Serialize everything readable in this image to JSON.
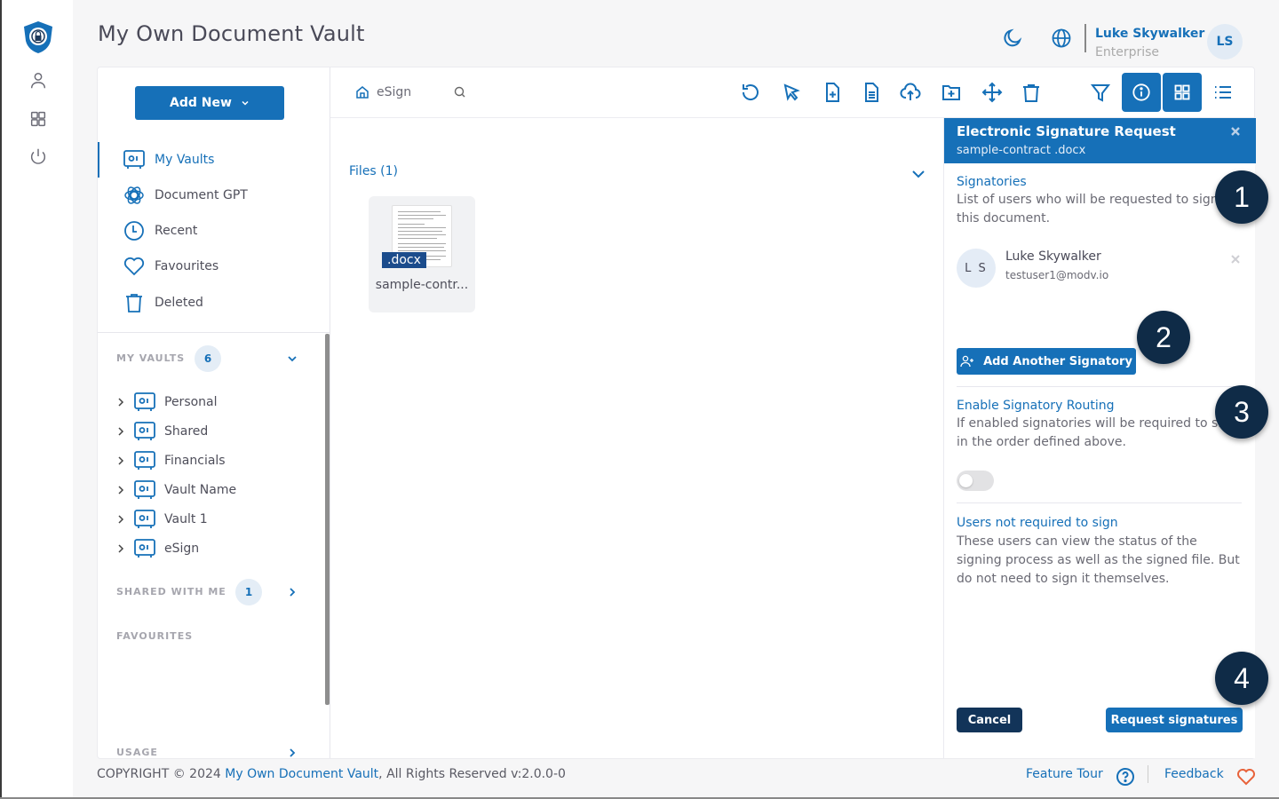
{
  "app": {
    "title": "My Own Document Vault"
  },
  "rail": {
    "icons": [
      "shield-logo",
      "user-icon",
      "grid-icon",
      "power-icon"
    ]
  },
  "header": {
    "icons": [
      "moon-icon",
      "globe-icon"
    ],
    "user": {
      "name": "Luke Skywalker",
      "plan": "Enterprise",
      "initials": "LS"
    }
  },
  "sidebar": {
    "add_new_label": "Add New",
    "nav": [
      {
        "label": "My Vaults",
        "icon": "vault-icon",
        "active": true
      },
      {
        "label": "Document GPT",
        "icon": "gpt-icon",
        "active": false
      },
      {
        "label": "Recent",
        "icon": "clock-icon",
        "active": false
      },
      {
        "label": "Favourites",
        "icon": "heart-icon",
        "active": false
      },
      {
        "label": "Deleted",
        "icon": "trash-icon",
        "active": false
      }
    ],
    "my_vaults": {
      "label": "MY VAULTS",
      "count": "6"
    },
    "vaults": [
      "Personal",
      "Shared",
      "Financials",
      "Vault Name",
      "Vault 1",
      "eSign"
    ],
    "shared_with_me": {
      "label": "SHARED WITH ME",
      "count": "1"
    },
    "favourites_label": "FAVOURITES",
    "usage_label": "USAGE"
  },
  "toolbar": {
    "breadcrumb": "eSign",
    "actions": [
      "refresh-icon",
      "select-icon",
      "new-file-icon",
      "document-icon",
      "upload-icon",
      "new-folder-icon",
      "move-icon",
      "delete-icon",
      "filter-icon",
      "info-icon",
      "grid-view-icon",
      "list-view-icon"
    ]
  },
  "files": {
    "label": "Files (1)",
    "items": [
      {
        "ext": ".docx",
        "name": "sample-contr..."
      }
    ]
  },
  "esign_panel": {
    "title": "Electronic Signature Request",
    "file": "sample-contract .docx",
    "signatories_heading": "Signatories",
    "signatories_text": "List of users who will be requested to sign this document.",
    "signers": [
      {
        "initials": "L S",
        "name": "Luke Skywalker",
        "email": "testuser1@modv.io"
      }
    ],
    "add_signatory_label": "Add Another Signatory",
    "routing_heading": "Enable Signatory Routing",
    "routing_text": "If enabled signatories will be required to sign in the order defined above.",
    "routing_enabled": false,
    "not_required_heading": "Users not required to sign",
    "not_required_text": "These users can view the status of the signing process as well as the signed file. But do not need to sign it themselves.",
    "cancel_label": "Cancel",
    "request_label": "Request signatures"
  },
  "steps": [
    "1",
    "2",
    "3",
    "4"
  ],
  "footer": {
    "copyright_prefix": "COPYRIGHT © 2024 ",
    "brand_link": "My Own Document Vault",
    "copyright_suffix": ", All Rights Reserved v:2.0.0-0",
    "feature_tour": "Feature Tour",
    "feedback": "Feedback"
  },
  "colors": {
    "primary": "#1670b8",
    "dark": "#123459",
    "step": "#0f2b47",
    "feedback_heart": "#e8623a"
  }
}
